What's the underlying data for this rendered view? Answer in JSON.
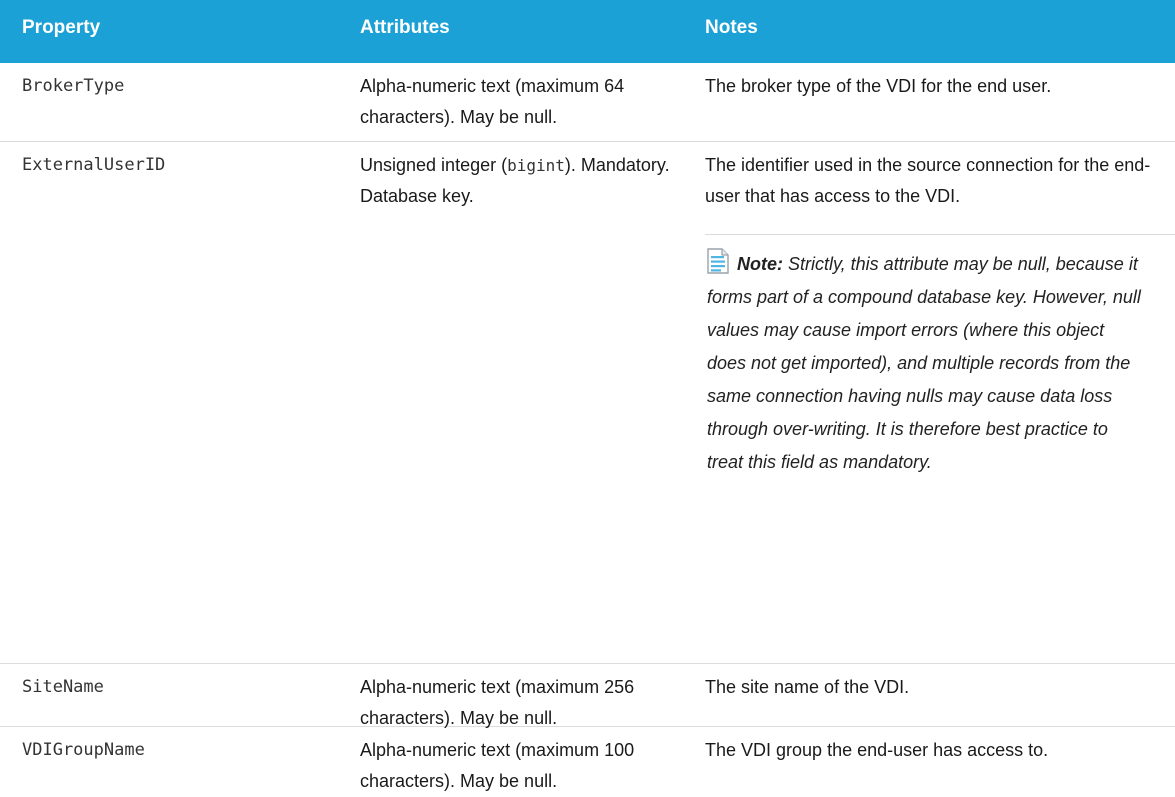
{
  "table": {
    "headers": [
      "Property",
      "Attributes",
      "Notes"
    ],
    "rows": [
      {
        "property": "BrokerType",
        "attributes": "Alpha-numeric text (maximum 64 characters). May be null.",
        "notes": "The broker type of the VDI for the end user."
      },
      {
        "property": "ExternalUserID",
        "attributes_pre": "Unsigned integer (",
        "attributes_code": "bigint",
        "attributes_post": "). Mandatory. Database key.",
        "notes": "The identifier used in the source connection for the end-user that has access to the VDI.",
        "note_label": "Note:",
        "note_text": " Strictly, this attribute may be null, because it forms part of a compound database key. However, null values may cause import errors (where this object does not get imported), and multiple records from the same connection having nulls may cause data loss through over-writing. It is therefore best practice to treat this field as mandatory."
      },
      {
        "property": "SiteName",
        "attributes": "Alpha-numeric text (maximum 256 characters). May be null.",
        "notes": "The site name of the VDI."
      },
      {
        "property": "VDIGroupName",
        "attributes": "Alpha-numeric text (maximum 100 characters). May be null.",
        "notes": "The VDI group the end-user has access to."
      }
    ]
  },
  "colors": {
    "header_bg": "#1ba1d5",
    "header_text": "#ffffff",
    "divider": "#dcdcdc"
  },
  "icons": {
    "note": "note-document-icon"
  }
}
